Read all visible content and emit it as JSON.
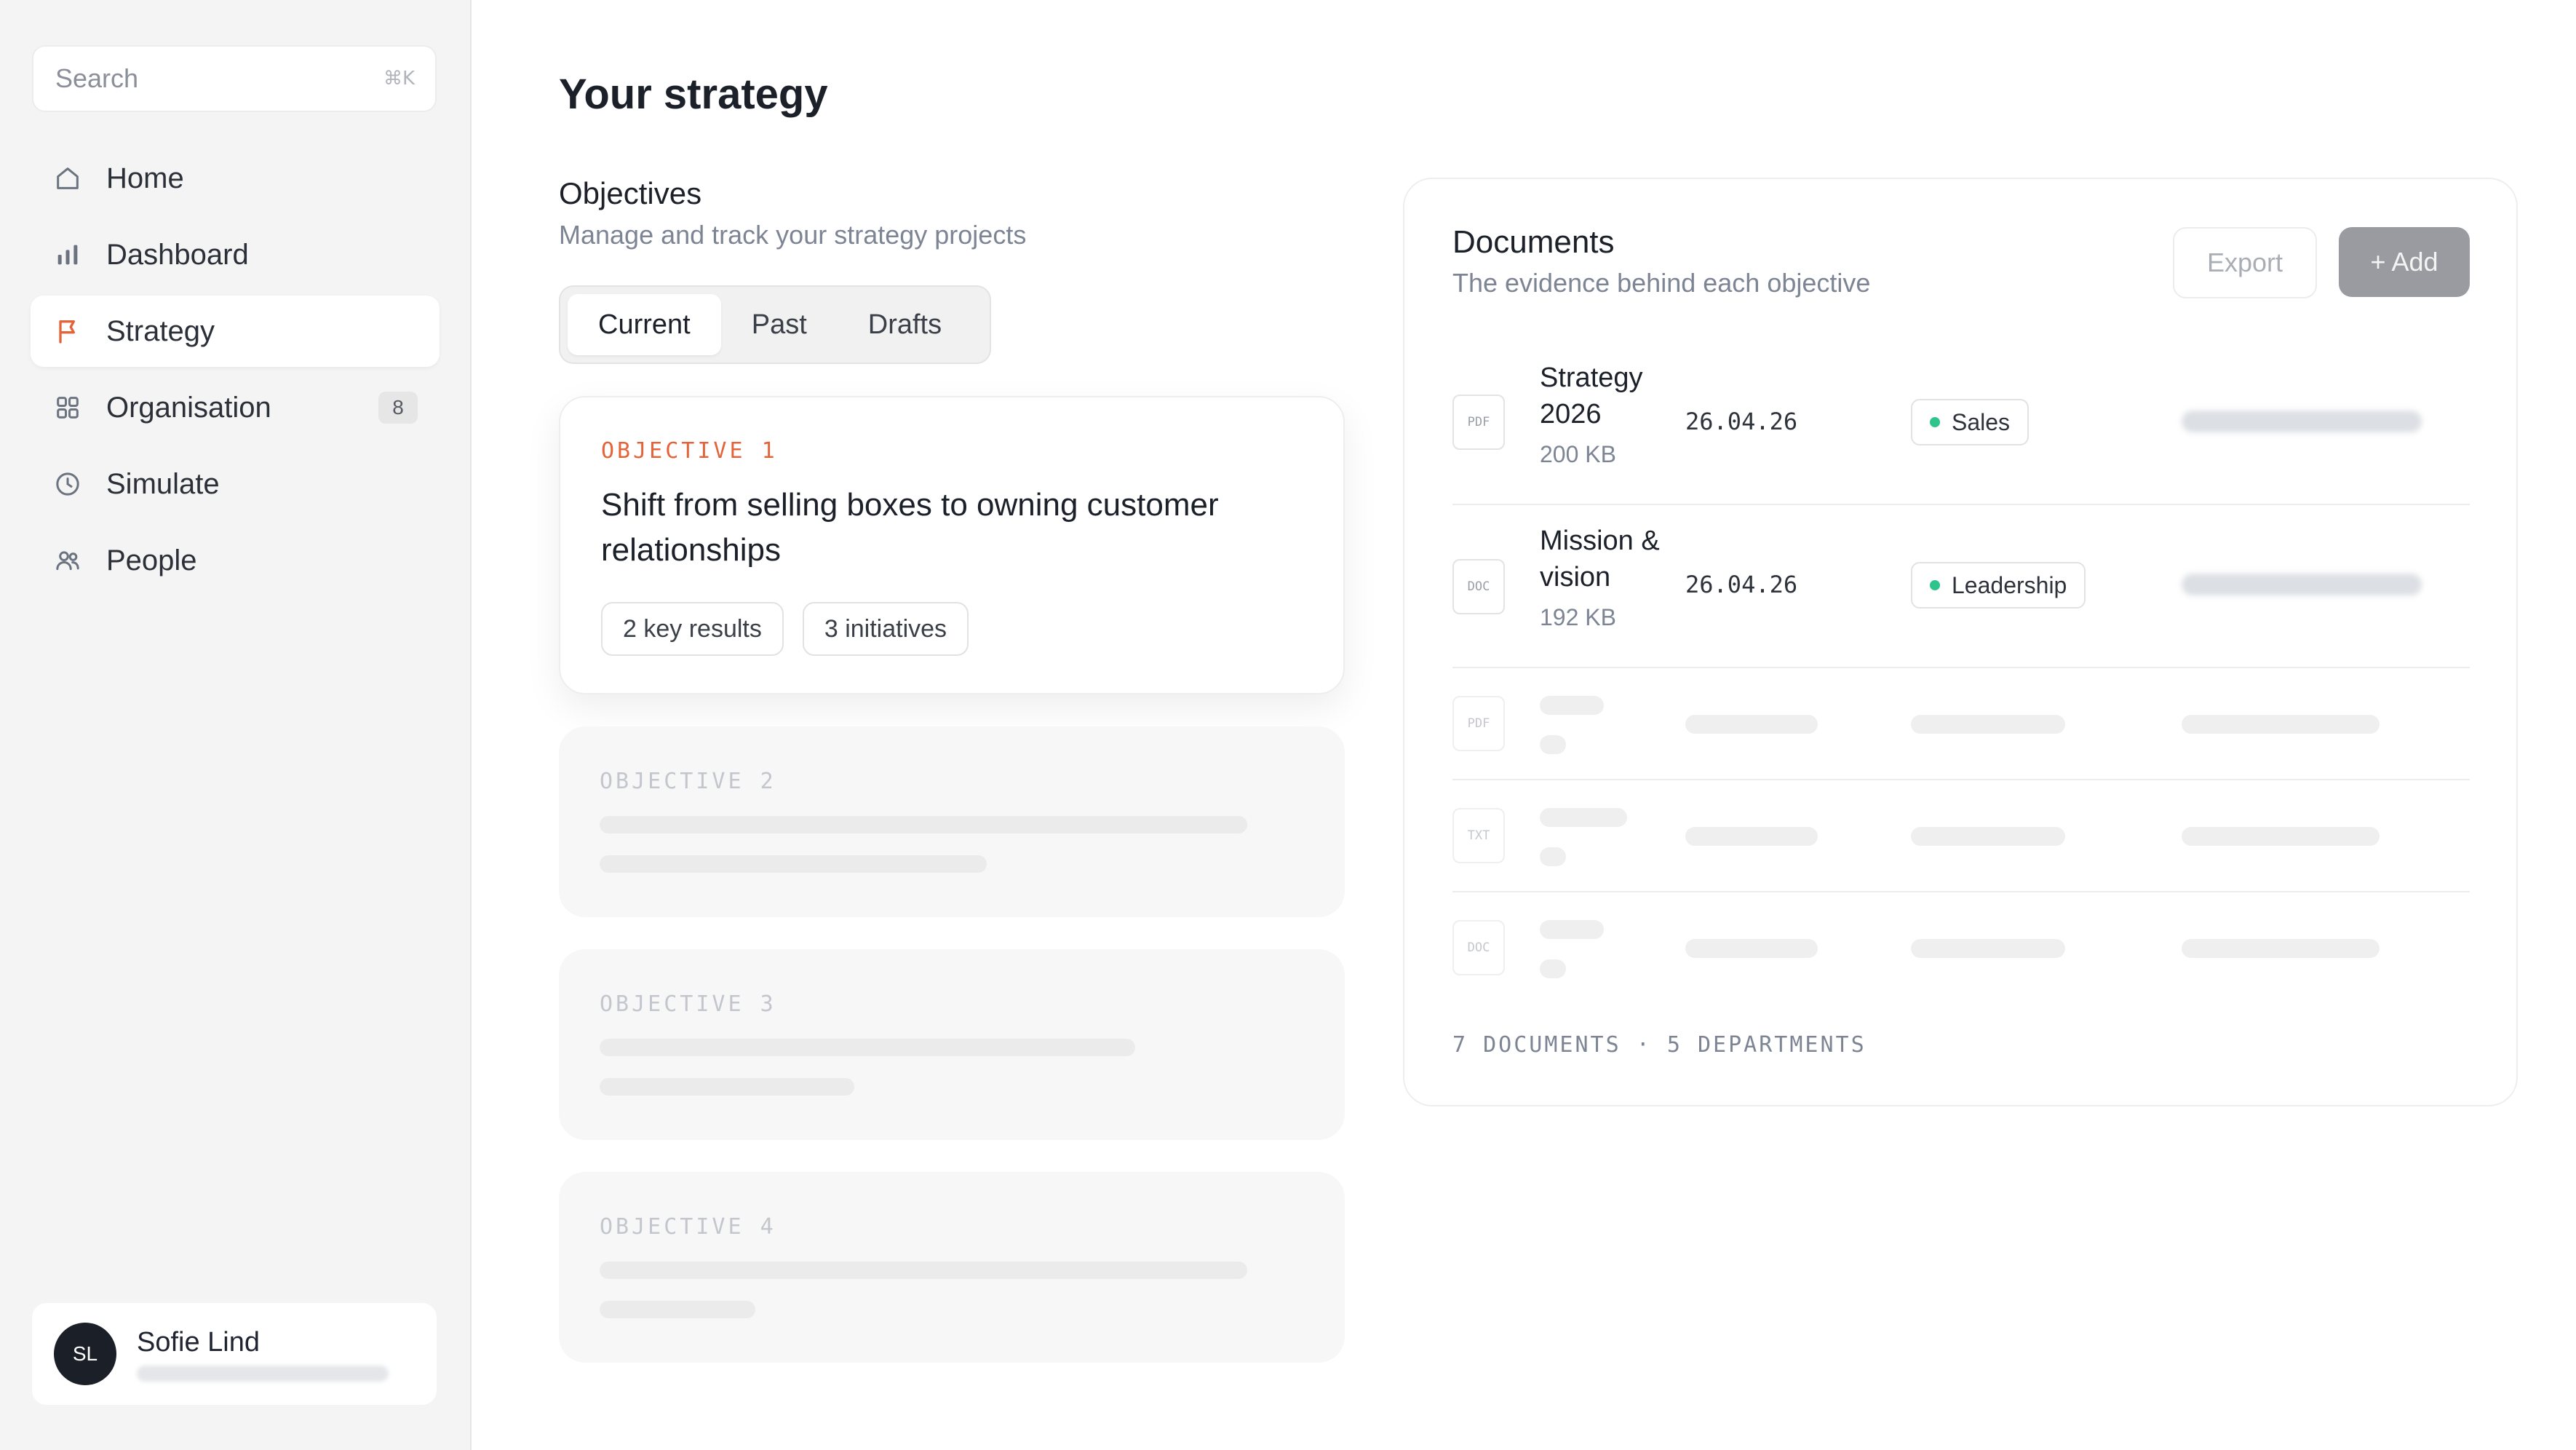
{
  "search": {
    "placeholder": "Search",
    "shortcut": "⌘K"
  },
  "sidebar": {
    "items": [
      {
        "label": "Home",
        "icon": "home-icon",
        "active": false
      },
      {
        "label": "Dashboard",
        "icon": "bar-chart-icon",
        "active": false
      },
      {
        "label": "Strategy",
        "icon": "flag-icon",
        "active": true
      },
      {
        "label": "Organisation",
        "icon": "grid-icon",
        "active": false,
        "badge": "8"
      },
      {
        "label": "Simulate",
        "icon": "clock-icon",
        "active": false
      },
      {
        "label": "People",
        "icon": "people-icon",
        "active": false
      }
    ],
    "user": {
      "initials": "SL",
      "name": "Sofie Lind"
    }
  },
  "main": {
    "title": "Your strategy",
    "objectives": {
      "title": "Objectives",
      "subtitle": "Manage and track your strategy projects",
      "tabs": [
        "Current",
        "Past",
        "Drafts"
      ],
      "active_tab": "Current",
      "cards": [
        {
          "kicker": "OBJECTIVE 1",
          "title": "Shift from selling boxes to owning customer relationships",
          "key_results": "2 key results",
          "initiatives": "3 initiatives"
        },
        {
          "kicker": "OBJECTIVE 2"
        },
        {
          "kicker": "OBJECTIVE 3"
        },
        {
          "kicker": "OBJECTIVE 4"
        }
      ]
    },
    "documents": {
      "title": "Documents",
      "subtitle": "The evidence behind each objective",
      "export_label": "Export",
      "add_label": "+ Add",
      "rows": [
        {
          "type": "PDF",
          "name": "Strategy 2026",
          "size": "200 KB",
          "date": "26.04.26",
          "department": "Sales"
        },
        {
          "type": "DOC",
          "name": "Mission & vision",
          "size": "192 KB",
          "date": "26.04.26",
          "department": "Leadership"
        }
      ],
      "placeholder_types": [
        "PDF",
        "TXT",
        "DOC"
      ],
      "footer": "7 DOCUMENTS · 5 DEPARTMENTS"
    }
  },
  "colors": {
    "accent_orange": "#e4643a",
    "status_green": "#2fc48b",
    "sidebar_bg": "#f4f4f4",
    "add_button": "#9a9ba0"
  }
}
